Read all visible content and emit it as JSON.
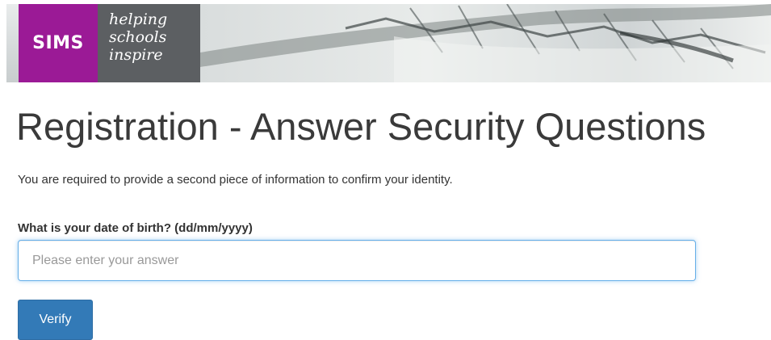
{
  "header": {
    "logo_text": "SIMS",
    "tagline": [
      "helping",
      "schools",
      "inspire"
    ],
    "brand_color": "#9b1a96"
  },
  "page": {
    "title": "Registration - Answer Security Questions",
    "intro": "You are required to provide a second piece of information to confirm your identity."
  },
  "form": {
    "question_label": "What is your date of birth? (dd/mm/yyyy)",
    "answer_value": "",
    "answer_placeholder": "Please enter your answer",
    "verify_label": "Verify",
    "accent_color": "#337ab7"
  }
}
